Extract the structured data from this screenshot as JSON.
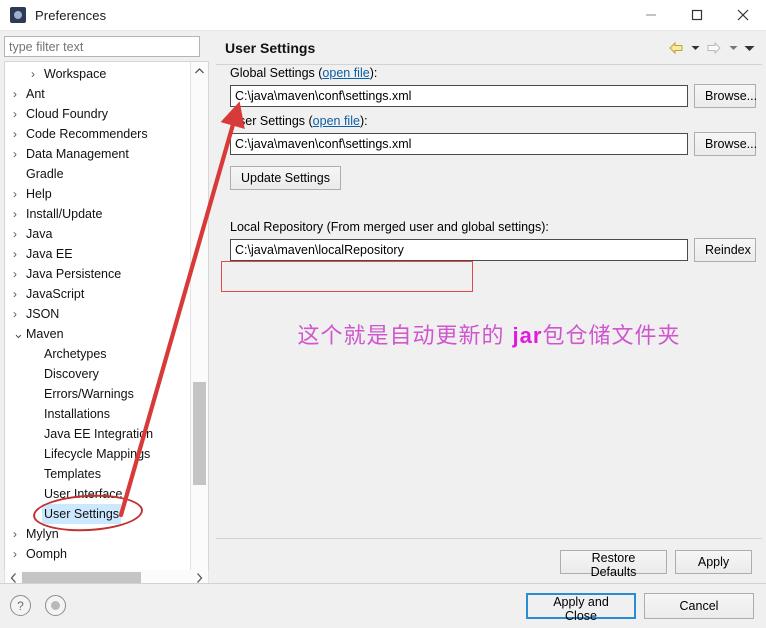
{
  "window": {
    "title": "Preferences",
    "icon": "preferences-gear-icon",
    "controls": {
      "minimize": "minimize-icon",
      "maximize": "maximize-icon",
      "close": "close-icon"
    }
  },
  "sidebar": {
    "filter_placeholder": "type filter text",
    "filter_value": "",
    "items": [
      {
        "label": "Workspace",
        "level": 2,
        "expandable": true,
        "expanded": false,
        "selected": false
      },
      {
        "label": "Ant",
        "level": 1,
        "expandable": true,
        "expanded": false,
        "selected": false
      },
      {
        "label": "Cloud Foundry",
        "level": 1,
        "expandable": true,
        "expanded": false,
        "selected": false
      },
      {
        "label": "Code Recommenders",
        "level": 1,
        "expandable": true,
        "expanded": false,
        "selected": false
      },
      {
        "label": "Data Management",
        "level": 1,
        "expandable": true,
        "expanded": false,
        "selected": false
      },
      {
        "label": "Gradle",
        "level": 1,
        "expandable": false,
        "expanded": false,
        "selected": false
      },
      {
        "label": "Help",
        "level": 1,
        "expandable": true,
        "expanded": false,
        "selected": false
      },
      {
        "label": "Install/Update",
        "level": 1,
        "expandable": true,
        "expanded": false,
        "selected": false
      },
      {
        "label": "Java",
        "level": 1,
        "expandable": true,
        "expanded": false,
        "selected": false
      },
      {
        "label": "Java EE",
        "level": 1,
        "expandable": true,
        "expanded": false,
        "selected": false
      },
      {
        "label": "Java Persistence",
        "level": 1,
        "expandable": true,
        "expanded": false,
        "selected": false
      },
      {
        "label": "JavaScript",
        "level": 1,
        "expandable": true,
        "expanded": false,
        "selected": false
      },
      {
        "label": "JSON",
        "level": 1,
        "expandable": true,
        "expanded": false,
        "selected": false
      },
      {
        "label": "Maven",
        "level": 1,
        "expandable": true,
        "expanded": true,
        "selected": false
      },
      {
        "label": "Archetypes",
        "level": 2,
        "expandable": false,
        "expanded": false,
        "selected": false
      },
      {
        "label": "Discovery",
        "level": 2,
        "expandable": false,
        "expanded": false,
        "selected": false
      },
      {
        "label": "Errors/Warnings",
        "level": 2,
        "expandable": false,
        "expanded": false,
        "selected": false
      },
      {
        "label": "Installations",
        "level": 2,
        "expandable": false,
        "expanded": false,
        "selected": false
      },
      {
        "label": "Java EE Integration",
        "level": 2,
        "expandable": false,
        "expanded": false,
        "selected": false
      },
      {
        "label": "Lifecycle Mappings",
        "level": 2,
        "expandable": false,
        "expanded": false,
        "selected": false
      },
      {
        "label": "Templates",
        "level": 2,
        "expandable": false,
        "expanded": false,
        "selected": false
      },
      {
        "label": "User Interface",
        "level": 2,
        "expandable": false,
        "expanded": false,
        "selected": false
      },
      {
        "label": "User Settings",
        "level": 2,
        "expandable": false,
        "expanded": false,
        "selected": true
      },
      {
        "label": "Mylyn",
        "level": 1,
        "expandable": true,
        "expanded": false,
        "selected": false
      },
      {
        "label": "Oomph",
        "level": 1,
        "expandable": true,
        "expanded": false,
        "selected": false
      }
    ]
  },
  "content": {
    "title": "User Settings",
    "nav": {
      "back": "back-arrow-icon",
      "back_menu": "chevron-down-icon",
      "forward": "forward-arrow-icon",
      "forward_menu": "chevron-down-icon",
      "view_menu": "chevron-down-icon"
    },
    "global_settings": {
      "label": "Global Settings (",
      "link": "open file",
      "label_suffix": "):",
      "value": "C:\\java\\maven\\conf\\settings.xml",
      "browse_label": "Browse..."
    },
    "user_settings": {
      "label": "User Settings (",
      "link": "open file",
      "label_suffix": "):",
      "value": "C:\\java\\maven\\conf\\settings.xml",
      "browse_label": "Browse..."
    },
    "update_settings_label": "Update Settings",
    "local_repository": {
      "label": "Local Repository (From merged user and global settings):",
      "value": "C:\\java\\maven\\localRepository",
      "reindex_label": "Reindex"
    },
    "annotation": {
      "text_before": "这个就是自动更新的 ",
      "highlight": "jar",
      "text_after": "包仓储文件夹",
      "color": "#cf56cf",
      "highlight_color": "#e01be0"
    },
    "restore_defaults_label": "Restore Defaults",
    "apply_label": "Apply"
  },
  "footer": {
    "help_icon": "help-question-icon",
    "secondary_icon": "gear-circle-icon",
    "apply_and_close_label": "Apply and Close",
    "cancel_label": "Cancel"
  },
  "annotations": {
    "rect_color": "#e04a4a",
    "ellipse_color": "#c23030",
    "arrow_color": "#d83a3a"
  }
}
